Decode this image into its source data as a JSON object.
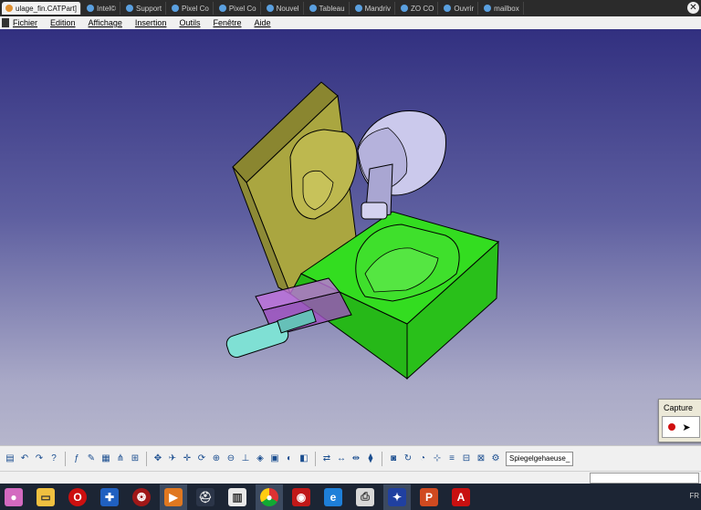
{
  "browser_tabs": [
    {
      "label": "ulage_fin.CATPart]",
      "active": true
    },
    {
      "label": "Intel©",
      "active": false
    },
    {
      "label": "Support",
      "active": false
    },
    {
      "label": "Pixel Co",
      "active": false
    },
    {
      "label": "Pixel Co",
      "active": false
    },
    {
      "label": "Nouvel",
      "active": false
    },
    {
      "label": "Tableau",
      "active": false
    },
    {
      "label": "Mandriv",
      "active": false
    },
    {
      "label": "ZO CO",
      "active": false
    },
    {
      "label": "Ouvrir",
      "active": false
    },
    {
      "label": "mailbox",
      "active": false
    }
  ],
  "window": {
    "title": "ulage_fin.CATPart]"
  },
  "menu": [
    "Fichier",
    "Edition",
    "Affichage",
    "Insertion",
    "Outils",
    "Fenêtre",
    "Aide"
  ],
  "capture": {
    "title": "Capture",
    "tools": [
      "record-icon",
      "pointer-icon"
    ]
  },
  "toolbar": {
    "part_selector": "Spiegelgehaeuse_",
    "icons": [
      "save-icon",
      "undo-icon",
      "redo-icon",
      "whats-this-icon",
      "formula-icon",
      "comment-icon",
      "table-icon",
      "tree-icon",
      "hierarchy-icon",
      "pan-icon",
      "fly-icon",
      "move-icon",
      "rotate-icon",
      "zoom-in-icon",
      "zoom-out-icon",
      "normal-view-icon",
      "iso-view-icon",
      "views-icon",
      "shading-icon",
      "hide-show-icon",
      "swap-icon",
      "measure-icon",
      "measure-between-icon",
      "apply-material-icon",
      "photo-icon",
      "update-icon",
      "sketch-icon",
      "axis-icon",
      "analysis-icon",
      "grid-icon",
      "parts-icon",
      "tools-icon"
    ]
  },
  "taskbar": {
    "apps": [
      "python-icon",
      "explorer-icon",
      "opera-icon",
      "defender-icon",
      "steam-icon",
      "media-icon",
      "hat-icon",
      "paper-icon",
      "chrome-icon",
      "video-icon",
      "ie-icon",
      "printer-icon",
      "paint-icon",
      "powerpoint-icon",
      "acrobat-icon"
    ],
    "tray": "FR"
  },
  "colors": {
    "bg_top": "#323080",
    "bg_bottom": "#b6b6cc",
    "mold_green": "#33dd20",
    "mold_olive": "#aaa640",
    "mold_lavender": "#cbc9ec",
    "insert_purple": "#a050c0",
    "insert_cyan": "#7fe0d4"
  }
}
